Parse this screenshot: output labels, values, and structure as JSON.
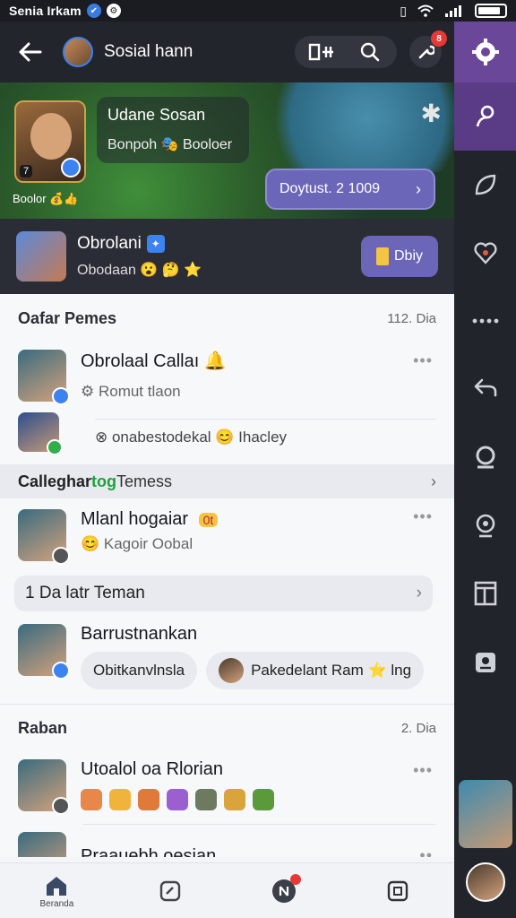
{
  "status_bar": {
    "title": "Senia Irkam",
    "signal_icon": "wifi-icon",
    "battery_icon": "battery-icon"
  },
  "header": {
    "title": "Sosial hann",
    "back_icon": "back-arrow-icon",
    "actions": [
      "grid-icon",
      "search-icon"
    ],
    "notif_badge": "8"
  },
  "hero": {
    "card_title": "Udane Sosan",
    "card_subtitle": "Bonpoh 🎭 Booloer",
    "rank": "7",
    "credit": "Boolor 💰👍",
    "pill_label": "Doytust. 2 1009",
    "pill_arrow": "›"
  },
  "group": {
    "name": "Obrolani",
    "subtitle": "Obodaan 😮 🤔 ⭐",
    "button_label": "Dbiy"
  },
  "section1": {
    "title": "Oafar Pemes",
    "meta": "112. Dia"
  },
  "row1": {
    "name": "Obrolaal Callaı 🔔",
    "sub": "⚙ Romut tlaon",
    "more": "•••",
    "thread": "⊗ onabestodekal 😊 Ihacley"
  },
  "category": {
    "label_a": "Calleghar",
    "label_b": "tog",
    "label_c": " Temess",
    "chevron": "›"
  },
  "row2": {
    "name": "Mlanl hogaiar",
    "tag": "0t",
    "sub": "😊 Kagoir Oobal",
    "more": "•••"
  },
  "pill_row": {
    "label": "1 Da latr Teman",
    "chevron": "›"
  },
  "row3": {
    "name": "Barrustnankan",
    "chip1": "Obitkanvlnsla",
    "chip2": "Pakedelant Ram ⭐ lng"
  },
  "section2": {
    "title": "Raban",
    "meta": "2. Dia"
  },
  "row4": {
    "name": "Utoalol oa Rlorian",
    "more": "•••"
  },
  "row5": {
    "name": "Praauebh oesian",
    "more": "••"
  },
  "tabs": [
    {
      "icon": "home-icon",
      "label": "Beranda"
    },
    {
      "icon": "edit-icon",
      "label": ""
    },
    {
      "icon": "chat-icon",
      "label": ""
    },
    {
      "icon": "screen-icon",
      "label": ""
    }
  ],
  "rail": {
    "items": [
      "settings-icon",
      "people-icon",
      "leaf-icon",
      "heart-icon",
      "more-icon",
      "reply-icon",
      "group-icon",
      "camera-icon",
      "layout-icon",
      "lock-icon"
    ]
  },
  "colors": {
    "accent": "#6c66b8",
    "rail_active": "#5a3b86",
    "header_bg": "#23252d",
    "badge": "#e53935"
  }
}
